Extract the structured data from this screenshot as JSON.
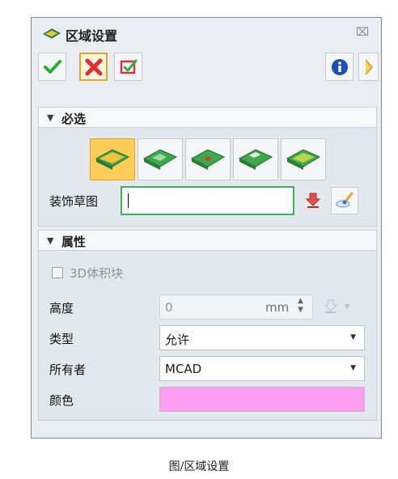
{
  "dialog": {
    "title": "区域设置",
    "close_symbol": "⌧"
  },
  "toolbar": {
    "ok_icon": "check-icon",
    "cancel_icon": "cross-icon",
    "apply_icon": "apply-icon",
    "info_icon": "info-icon",
    "more_icon": "arrow-right-icon"
  },
  "section_select": {
    "arrow": "▼",
    "title": "必选",
    "sketch_label": "装饰草图",
    "sketch_value": "",
    "sketch_buttons": [
      "region-sketch-1",
      "region-sketch-2",
      "region-sketch-3",
      "region-sketch-4",
      "region-sketch-5"
    ]
  },
  "section_props": {
    "arrow": "▼",
    "title": "属性",
    "checkbox_label": "3D体积块",
    "checkbox_checked": false,
    "height_label": "高度",
    "height_value": "0",
    "height_unit": "mm",
    "type_label": "类型",
    "type_value": "允许",
    "owner_label": "所有者",
    "owner_value": "MCAD",
    "color_label": "颜色",
    "color_value": "#ff9ff3"
  },
  "caption": "图/区域设置"
}
